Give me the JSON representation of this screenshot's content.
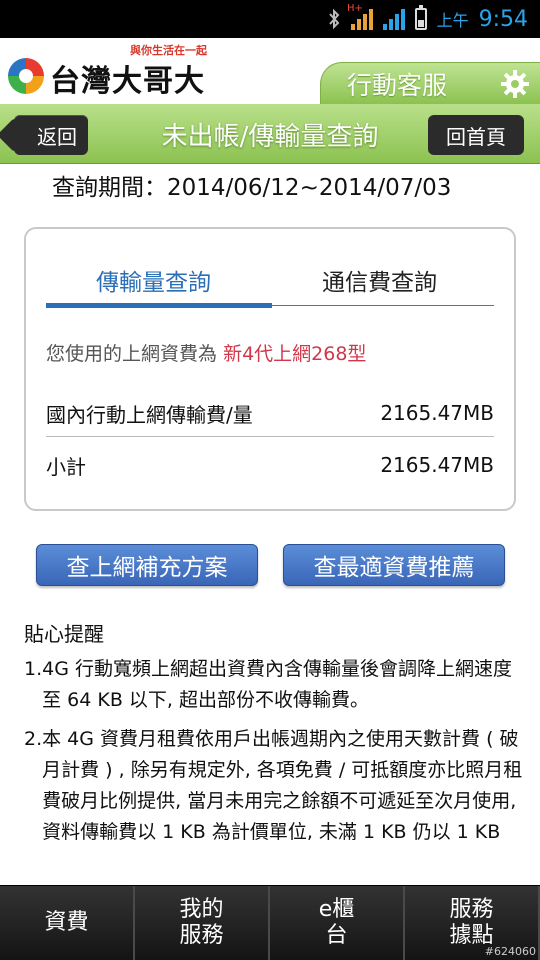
{
  "status_bar": {
    "network_label": "H+",
    "ampm": "上午",
    "time": "9:54",
    "icons": [
      "bluetooth-icon",
      "signal-icon",
      "wifi-signal-icon",
      "battery-icon"
    ]
  },
  "brand": {
    "slogan": "與你生活在一起",
    "name": "台灣大哥大",
    "service_label": "行動客服",
    "service_icon": "gear-icon"
  },
  "nav": {
    "back_label": "返回",
    "title": "未出帳/傳輸量查詢",
    "home_label": "回首頁"
  },
  "query": {
    "period_label": "查詢期間：2014/06/12~2014/07/03"
  },
  "tabs": [
    {
      "label": "傳輸量查詢",
      "active": true
    },
    {
      "label": "通信費查詢",
      "active": false
    }
  ],
  "usage": {
    "plan_prefix": "您使用的上網資費為",
    "plan_name": "新4代上網268型",
    "rows": [
      {
        "label": "國內行動上網傳輸費/量",
        "value": "2165.47MB"
      },
      {
        "label": "小計",
        "value": "2165.47MB"
      }
    ]
  },
  "actions": {
    "supplement_label": "查上網補充方案",
    "recommend_label": "查最適資費推薦"
  },
  "reminders": {
    "title": "貼心提醒",
    "items": [
      {
        "num": "1.",
        "text": "4G 行動寬頻上網超出資費內含傳輸量後會調降上網速度至 64 KB 以下, 超出部份不收傳輸費。"
      },
      {
        "num": "2.",
        "text": "本 4G 資費月租費依用戶出帳週期內之使用天數計費 ( 破月計費 ) , 除另有規定外, 各項免費 / 可抵額度亦比照月租費破月比例提供, 當月未用完之餘額不可遞延至次月使用, 資料傳輸費以 1 KB 為計價單位, 未滿 1 KB 仍以 1 KB"
      }
    ]
  },
  "bottom_nav": [
    {
      "label": "資費"
    },
    {
      "label": "我的服務"
    },
    {
      "label": "e櫃台"
    },
    {
      "label": "服務據點"
    }
  ],
  "watermark": "#624060",
  "colors": {
    "accent_green": "#8cc251",
    "tab_blue": "#2b6fb6",
    "plan_red": "#d0384a",
    "button_blue": "#3a66b8"
  }
}
